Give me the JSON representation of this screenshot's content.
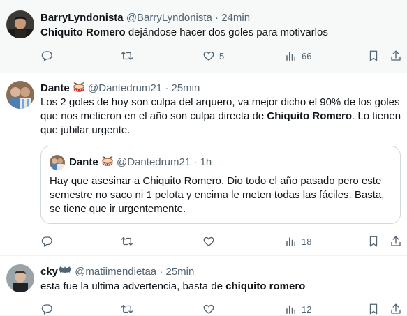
{
  "tweets": [
    {
      "name": "BarryLyndonista",
      "handle": "@BarryLyndonista",
      "sep": "·",
      "time": "24min",
      "text_bold_1": "Chiquito Romero",
      "text_rest_1": " dejándose hacer dos goles para motivarlos",
      "likes": "5",
      "views": "66"
    },
    {
      "name": "Dante",
      "handle": "@Dantedrum21",
      "sep": "·",
      "time": "25min",
      "text_part_1": "Los 2 goles de hoy son culpa del arquero, va mejor dicho el 90% de los goles que nos metieron en el año son culpa directa de ",
      "text_bold_1": "Chiquito Romero",
      "text_part_2": ". Lo tienen que jubilar urgente.",
      "views": "18",
      "quote": {
        "name": "Dante",
        "handle": "@Dantedrum21",
        "sep": "·",
        "time": "1h",
        "text": "Hay que asesinar a Chiquito Romero. Dio todo el año pasado pero este semestre no saco ni 1 pelota y encima le meten todas las fáciles. Basta, se tiene que ir urgentemente."
      }
    },
    {
      "name": "cky",
      "handle": "@matiimendietaa",
      "sep": "·",
      "time": "25min",
      "text_part_1": "esta fue la ultima advertencia, basta de ",
      "text_bold_1": "chiquito romero",
      "views": "12"
    }
  ],
  "colors": {
    "text": "#0f1419",
    "muted": "#536471",
    "border": "#cfd9de",
    "highlight_bg": "#f7f9f9"
  },
  "icons": [
    "reply-icon",
    "retweet-icon",
    "like-icon",
    "views-icon",
    "bookmark-icon",
    "share-icon",
    "drum-icon",
    "batman-icon"
  ]
}
